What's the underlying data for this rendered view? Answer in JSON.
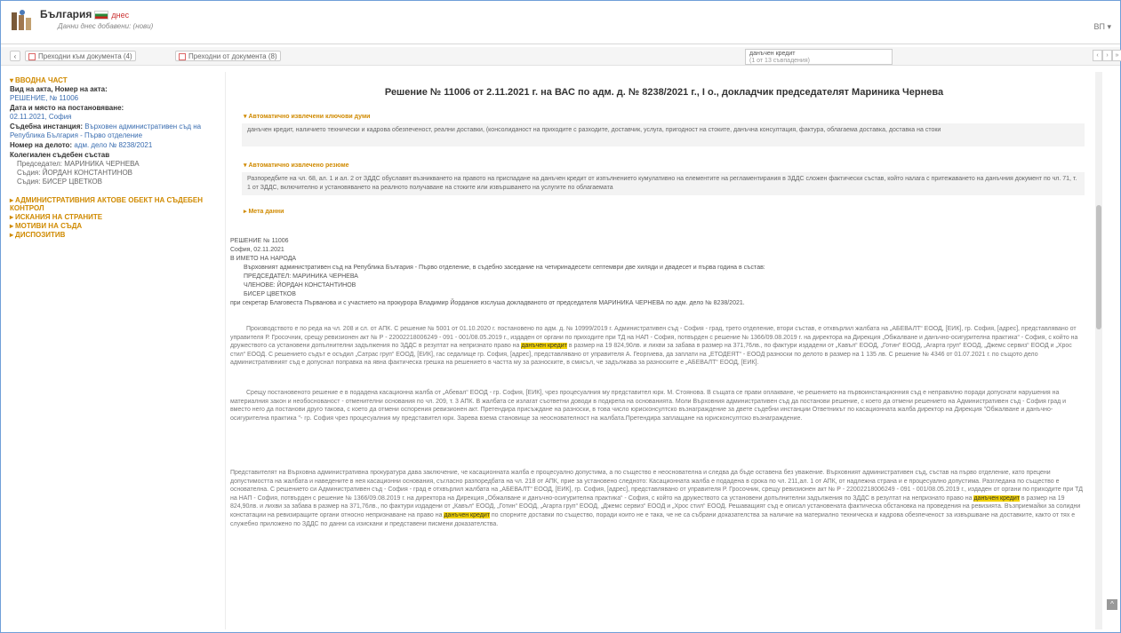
{
  "header": {
    "brand": "България",
    "brand_update": "днес",
    "subtitle": "Данни днес добавени: (нови)",
    "user": "ВП ▾"
  },
  "toolbar": {
    "back": "‹",
    "btn1": "Преходни към документа (4)",
    "btn2": "Преходни от документа (8)",
    "search_value": "данъчен кредит",
    "search_count": "(1 от 13 съвпадения)",
    "nav_prev": "‹",
    "nav_next": "›",
    "nav_last": "»"
  },
  "left": {
    "intro_section": "ВВОДНА ЧАСТ",
    "type_label": "Вид на акта, Номер на акта:",
    "type_value": "РЕШЕНИЕ, № 11006",
    "date_label": "Дата и място на постановяване:",
    "date_value": "02.11.2021, София",
    "court_label": "Съдебна инстанция:",
    "court_value": "Върховен административен съд на Република България - Първо отделение",
    "case_label": "Номер на делото:",
    "case_value": "адм. дело № 8238/2021",
    "panel_label": "Колегиален съдебен състав",
    "panel_members": [
      "Председател: МАРИНИКА ЧЕРНЕВА",
      "Съдия: ЙОРДАН КОНСТАНТИНОВ",
      "Съдия: БИСЕР ЦВЕТКОВ"
    ],
    "sections": [
      "АДМИНИСТРАТИВНИЯ АКТОВЕ ОБЕКТ НА СЪДЕБЕН КОНТРОЛ",
      "ИСКАНИЯ НА СТРАНИТЕ",
      "МОТИВИ НА СЪДА",
      "ДИСПОЗИТИВ"
    ]
  },
  "main": {
    "title": "Решение № 11006 от 2.11.2021 г. на ВАС по адм. д. № 8238/2021 г., I о., докладчик председателят Мариника Чернева",
    "kw_section": "Автоматично извлечени ключови думи",
    "kw_text": "данъчен кредит, наличието технически и кадрова обезпеченост, реални доставки, (консолиданост на приходите с разходите, доставчик, услуга, пригодност на стоките, данъчна консултация, фактура, облагаема доставка, доставка на стоки",
    "summary_section": "Автоматично извлечено резюме",
    "summary_text": "Разпоредбите на чл. 68, ал. 1 и ал. 2 от ЗДДС обуславят възникването на правото на приспадане на данъчен кредит от изпълнението кумулативно на елементите на регламентирания в ЗДДС сложен фактически състав, който налага с притежаването на данъчния документ по чл. 71, т. 1 от ЗДДС, включително и установяването на реалното получаване на стоките или извършването на услугите по облагаемата",
    "meta_section": "Мета данни",
    "doc_lines": [
      "РЕШЕНИЕ № 11006",
      "София, 02.11.2021",
      "В ИМЕТО НА НАРОДА"
    ],
    "doc_intro": "Върховният административен съд на Република България - Първо отделение, в съдебно заседание на четиринадесети септември две хиляди и двадесет и първа година в състав:",
    "panel_lines": [
      "ПРЕДСЕДАТЕЛ: МАРИНИКА ЧЕРНЕВА",
      "ЧЛЕНОВЕ: ЙОРДАН КОНСТАНТИНОВ",
      "БИСЕР ЦВЕТКОВ"
    ],
    "secretary_line": "при секретар Благовеста Първанова и с участието на прокурора Владимир Йорданов изслуша докладваното от председателя МАРИНИКА ЧЕРНЕВА по адм. дело № 8238/2021.",
    "para1_a": "Производството е по реда на чл. 208 и сл. от АПК. С решение № 5001 от 01.10.2020 г. постановено по адм. д. № 10999/2019 г. Административен съд - София - град, трето отделение, втори състав, е отхвърлил жалбата на „АБЕВАЛТ“ ЕООД, [ЕИК], гр. София, [адрес], представлявано от управителя Р. Гросочник, срещу ревизионен акт № Р - 22002218006249 - 091 - 001/08.05.2019 г., издаден от органи по приходите при ТД на НАП - София, потвърден с решение № 1366/09.08.2019 г. на директора на Дирекция „Обжалване и данъчно-осигурителна практика“ - София, с който на дружеството са установени допълнителни задължения по ЗДДС в резултат на непризнато право на",
    "hl1": "данъчен кредит",
    "para1_b": "в размер на 19 824,90лв. и лихви за забава в размер на 371,76лв., по фактури издадени от „Кавъл“ ЕООД, „Готин“ ЕООД, „Агарта груп“ ЕООД, „Джемс сервиз“ ЕООД и „Хрос стил“ ЕООД. С решението съдът е осъдил „Сатрас груп“ ЕООД, [ЕИК], гас седалище гр. София, [адрес], представлявано от управителя А. Георгиева, да заплати на „ЕТОДЕЯТ“ - ЕООД разноски по делото в размер на 1 135 лв. С решение № 4346 от 01.07.2021 г. по същото дело административният съд е допуснал поправка на явна фактическа грешка на решението в частта му за разноските, в смисъл, че задължава за разноските е „АБЕВАЛТ“ ЕООД, [ЕИК].",
    "para2": "Срещу постановеното решение е в подадена касационна жалба от „Абевал“ ЕООД - гр. София, [ЕИК], чрез процесуалния му представител юрк. М. Стоянова. В същата се прави оплакване, че решението на първоинстанционния съд е неправилно поради допуснати нарушения на материалния закон и необоснованост - отменителни основания по чл. 209, т. 3 АПК. В жалбата се излагат съответни доводи в подкрепа на основанията. Моли Върховния административен съд да постанови решение, с което да отмени решението на Административен съд - София град и вместо него да постанови друго такова, с което да отмени оспорения ревизионен акт. Претендира присъждане на разноски, в това число юрисконсултско възнаграждение за двете съдебни инстанции Ответникът по касационната жалба директор на Дирекция \"Обжалване и данъчно-осигурителна практика \"- гр. София чрез процесуалния му представител юрк. Зарева взема становище за неоснователност на жалбата.Претендира заплащане на юрисконсултско възнаграждение.",
    "para3_a": "Представителят на Върховна административна прокуратура дава заключение, че касационната жалба е процесуално допустима, а по същество е неоснователна и следва да бъде оставена без уважение. Върховният административен съд, състав на първо отделение, като прецени допустимостта на жалбата и наведените в нея касационни основания, съгласно разпоредбата на чл. 218 от АПК, прие за установено следното: Касационната жалба е подадена в срока по чл. 211,ал. 1 от АПК, от надлежна страна и е процесуално допустима. Разгледана по същество е основателна. С решението си Административен съд - София - град е отхвърлил жалбата на „АБЕВАЛТ“ ЕООД, [ЕИК], гр. София, [адрес], представлявано от управителя Р. Гросочник, срещу ревизионен акт № Р - 22002218006249 - 091 - 001/08.05.2019 г., издаден от органи по приходите при ТД на НАП - София, потвърден с решение № 1366/09.08.2019 г. на директора на Дирекция „Обжалване и данъчно-осигурителна практика“ - София, с който на дружеството са установени допълнителни задължения по ЗДДС в резултат на непризнато право на",
    "hl2": "данъчен кредит",
    "para3_b": "в размер на 19 824,90лв. и лихви за забава в размер на 371,76лв., по фактури издадени от „Кавъл“ ЕООД, „Готин“ ЕООД, „Агарта груп“ ЕООД, „Джемс сервиз“ ЕООД и „Хрос стил“ ЕООД. Решаващият съд е описал установената фактическа обстановка на проведения на ревизията. Възприемайки за солидни констатации на ревизиращите органи относно непризнаване на право на",
    "hl3": "данъчен кредит",
    "para3_c": "по спорните доставки по същество, поради които не е така, че не са събрани доказателства за наличие на материално техническа и кадрова обезпеченост за извършване на доставките, както от тях е служебно приложено по ЗДДС по данни са изискани и представени писмени доказателства."
  }
}
